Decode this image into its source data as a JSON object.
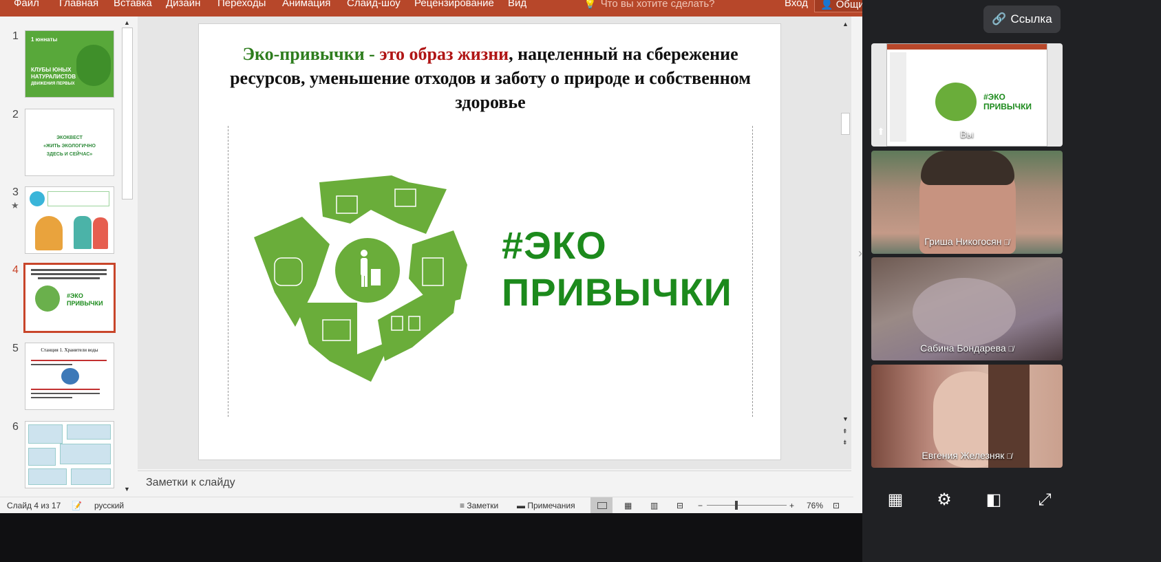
{
  "ribbon": {
    "tabs": [
      "Файл",
      "Главная",
      "Вставка",
      "Дизайн",
      "Переходы",
      "Анимация",
      "Слайд-шоу",
      "Рецензирование",
      "Вид"
    ],
    "tell_me": "Что вы хотите сделать?",
    "login": "Вход",
    "share": "Общий доступ",
    "color": "#b7472a"
  },
  "thumbnails": [
    {
      "number": "1",
      "lines": [
        "КЛУБЫ ЮНЫХ",
        "НАТУРАЛИСТОВ",
        "ДВИЖЕНИЯ ПЕРВЫХ"
      ],
      "logo": "1 юннаты"
    },
    {
      "number": "2",
      "lines": [
        "ЭКОКВЕСТ",
        "«ЖИТЬ ЭКОЛОГИЧНО",
        "ЗДЕСЬ И СЕЙЧАС»"
      ]
    },
    {
      "number": "3"
    },
    {
      "number": "4",
      "lines": [
        "#ЭКО",
        "ПРИВЫЧКИ"
      ]
    },
    {
      "number": "5",
      "lines": [
        "Станция 1. Хранители воды"
      ]
    },
    {
      "number": "6"
    }
  ],
  "selected_slide": "4",
  "slide": {
    "title_green": "Эко-привычки - ",
    "title_red": "это образ жизни",
    "title_rest": ", нацеленный на сбережение ресурсов, уменьшение  отходов и заботу о природе и собственном здоровье",
    "eko_line1": "#ЭКО",
    "eko_line2": "ПРИВЫЧКИ",
    "accent": "#1c8a1c"
  },
  "notes_placeholder": "Заметки к слайду",
  "status": {
    "slide_counter": "Слайд 4 из 17",
    "language": "русский",
    "notes": "Заметки",
    "comments": "Примечания",
    "zoom": "76%"
  },
  "call": {
    "link_button": "Ссылка",
    "participants": [
      {
        "name": "Вы",
        "muted": false
      },
      {
        "name": "Гриша Никогосян",
        "muted": true
      },
      {
        "name": "Сабина Бондарева",
        "muted": true
      },
      {
        "name": "Евгения Железняк",
        "muted": true
      }
    ],
    "toolbar": [
      "grid-icon",
      "settings-gear-icon",
      "picture-in-picture-icon",
      "fullscreen-icon"
    ]
  }
}
